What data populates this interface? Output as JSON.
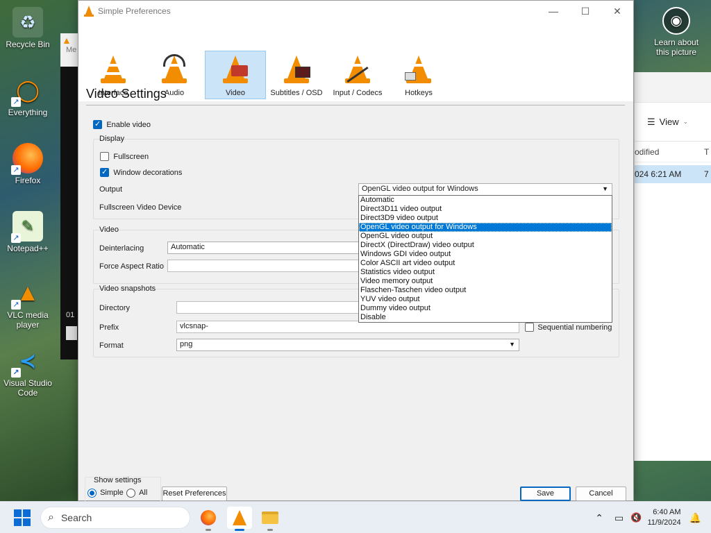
{
  "desktop": {
    "icons": [
      {
        "label": "Recycle Bin",
        "glyph": "♻"
      },
      {
        "label": "Everything",
        "glyph": "🔍"
      },
      {
        "label": "Firefox",
        "glyph": "🦊"
      },
      {
        "label": "Notepad++",
        "glyph": "📝"
      },
      {
        "label": "VLC media player",
        "glyph": "▲"
      },
      {
        "label": "Visual Studio Code",
        "glyph": "⟨⟩"
      }
    ],
    "learn_label": "Learn about this picture"
  },
  "explorer": {
    "view_label": "View",
    "col_modified": "odified",
    "col_type": "T",
    "row_date": "024 6:21 AM",
    "row_type": "7"
  },
  "bg_vlc": {
    "tab_label": "Me",
    "time": "01"
  },
  "dialog": {
    "title": "Simple Preferences",
    "tabs": [
      {
        "label": "Interface",
        "icon": "interface-icon"
      },
      {
        "label": "Audio",
        "icon": "audio-icon"
      },
      {
        "label": "Video",
        "icon": "video-icon"
      },
      {
        "label": "Subtitles / OSD",
        "icon": "subtitles-icon"
      },
      {
        "label": "Input / Codecs",
        "icon": "input-codecs-icon"
      },
      {
        "label": "Hotkeys",
        "icon": "hotkeys-icon"
      }
    ],
    "active_tab": "Video",
    "heading": "Video Settings",
    "enable_video": {
      "label": "Enable video",
      "checked": true
    },
    "display": {
      "group_label": "Display",
      "fullscreen": {
        "label": "Fullscreen",
        "checked": false
      },
      "window_decorations": {
        "label": "Window decorations",
        "checked": true
      },
      "output_label": "Output",
      "output_value": "OpenGL video output for Windows",
      "fullscreen_device_label": "Fullscreen Video Device"
    },
    "output_options": [
      "Automatic",
      "Direct3D11 video output",
      "Direct3D9 video output",
      "OpenGL video output for Windows",
      "OpenGL video output",
      "DirectX (DirectDraw) video output",
      "Windows GDI video output",
      "Color ASCII art video output",
      "Statistics video output",
      "Video memory output",
      "Flaschen-Taschen video output",
      "YUV video output",
      "Dummy video output",
      "Disable"
    ],
    "output_selected_index": 3,
    "video": {
      "group_label": "Video",
      "deinterlacing_label": "Deinterlacing",
      "deinterlacing_value": "Automatic",
      "aspect_label": "Force Aspect Ratio",
      "aspect_value": ""
    },
    "snapshots": {
      "group_label": "Video snapshots",
      "directory_label": "Directory",
      "directory_value": "",
      "prefix_label": "Prefix",
      "prefix_value": "vlcsnap-",
      "sequential_label": "Sequential numbering",
      "sequential_checked": false,
      "format_label": "Format",
      "format_value": "png"
    },
    "show_settings": {
      "label": "Show settings",
      "simple": "Simple",
      "all": "All",
      "selected": "Simple"
    },
    "reset_label": "Reset Preferences",
    "save_label": "Save",
    "cancel_label": "Cancel"
  },
  "taskbar": {
    "search_placeholder": "Search",
    "time": "6:40 AM",
    "date": "11/9/2024"
  }
}
